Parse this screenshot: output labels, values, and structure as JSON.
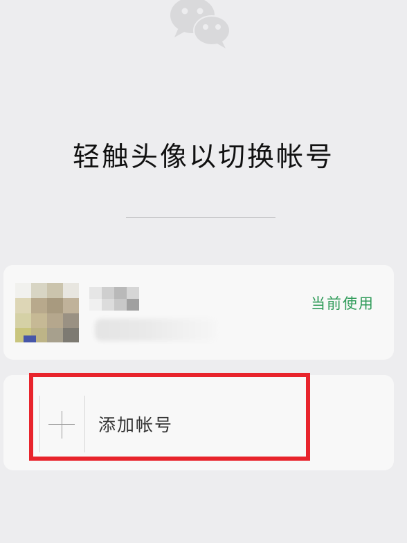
{
  "header": {
    "logo_icon": "wechat-logo-icon",
    "title": "轻触头像以切换帐号"
  },
  "accounts": [
    {
      "nickname": "",
      "status_label": "当前使用",
      "status_color": "#2f9b59",
      "avatar_icon": "pixelated-avatar"
    }
  ],
  "add_account": {
    "icon": "plus-icon",
    "label": "添加帐号"
  },
  "annotation": {
    "color": "#e8242c"
  }
}
